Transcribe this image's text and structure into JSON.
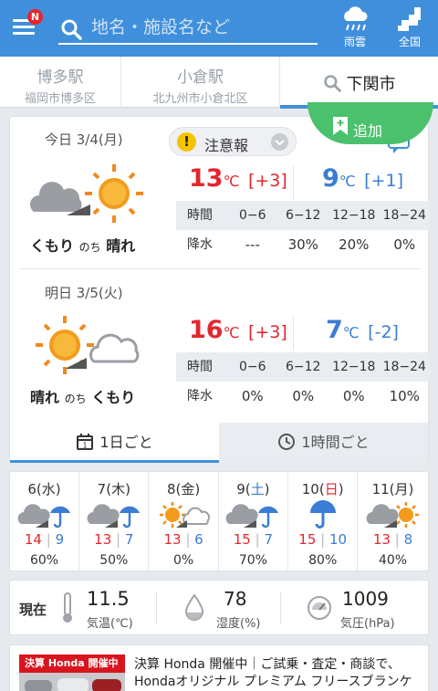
{
  "header": {
    "badge": "N",
    "search_placeholder": "地名・施設名など",
    "radar_label": "雨雲",
    "national_label": "全国"
  },
  "location_tabs": [
    {
      "name": "博多駅",
      "sub": "福岡市博多区"
    },
    {
      "name": "小倉駅",
      "sub": "北九州市小倉北区"
    },
    {
      "name": "下関市"
    }
  ],
  "add_button": "追加",
  "today": {
    "date": "今日 3/4(月)",
    "warning": "注意報",
    "condition_a": "くもり",
    "condition_join": "のち",
    "condition_b": "晴れ",
    "high": "13",
    "high_diff": "[+3]",
    "low": "9",
    "low_diff": "[+1]",
    "time_header": "時間",
    "rain_header": "降水",
    "slots": [
      "0−6",
      "6−12",
      "12−18",
      "18−24"
    ],
    "rain": [
      "---",
      "30%",
      "20%",
      "0%"
    ]
  },
  "tomorrow": {
    "date": "明日 3/5(火)",
    "condition_a": "晴れ",
    "condition_join": "のち",
    "condition_b": "くもり",
    "high": "16",
    "high_diff": "[+3]",
    "low": "7",
    "low_diff": "[-2]",
    "time_header": "時間",
    "rain_header": "降水",
    "slots": [
      "0−6",
      "6−12",
      "12−18",
      "18−24"
    ],
    "rain": [
      "0%",
      "0%",
      "0%",
      "10%"
    ]
  },
  "unit": "℃",
  "view_tabs": {
    "daily": "1日ごと",
    "hourly": "1時間ごと"
  },
  "weekly": [
    {
      "date_num": "6",
      "dow": "水",
      "dow_color": "#333333",
      "icon": "cloud-rain",
      "high": "14",
      "low": "9",
      "rain": "60%"
    },
    {
      "date_num": "7",
      "dow": "木",
      "dow_color": "#333333",
      "icon": "cloud-rain",
      "high": "13",
      "low": "7",
      "rain": "50%"
    },
    {
      "date_num": "8",
      "dow": "金",
      "dow_color": "#333333",
      "icon": "sun-cloud",
      "high": "13",
      "low": "6",
      "rain": "0%"
    },
    {
      "date_num": "9",
      "dow": "土",
      "dow_color": "#3b7cd4",
      "icon": "cloud-rain",
      "high": "15",
      "low": "7",
      "rain": "70%"
    },
    {
      "date_num": "10",
      "dow": "日",
      "dow_color": "#e3262e",
      "icon": "rain",
      "high": "15",
      "low": "10",
      "rain": "80%"
    },
    {
      "date_num": "11",
      "dow": "月",
      "dow_color": "#333333",
      "icon": "cloud-sun",
      "high": "13",
      "low": "8",
      "rain": "40%"
    }
  ],
  "current": {
    "label": "現在",
    "temp": "11.5",
    "temp_label": "気温(℃)",
    "humidity": "78",
    "humidity_label": "湿度(%)",
    "pressure": "1009",
    "pressure_label": "気圧(hPa)"
  },
  "ad": {
    "banner": "決算 Honda 開催中",
    "line1": "決算 Honda 開催中｜ご試乗・査定・商談で、",
    "line2": "Hondaオリジナル プレミアム フリースブランケ"
  },
  "colors": {
    "header": "#3f8fdc",
    "high": "#e3262e",
    "low": "#3b7cd4",
    "add_button": "#4bc16d",
    "warning": "#f5c400"
  }
}
